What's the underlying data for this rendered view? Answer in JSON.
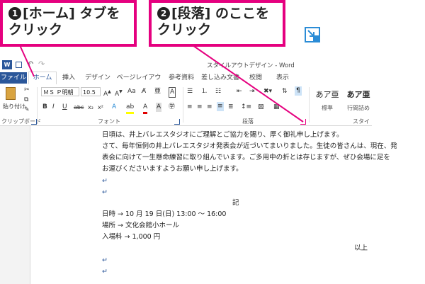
{
  "callouts": [
    {
      "num": "❶",
      "line1": "[ホーム] タブを",
      "line2": "クリック"
    },
    {
      "num": "❷",
      "line1": "[段落] のここを",
      "line2": "クリック"
    }
  ],
  "window": {
    "title": "スタイルアウトデザイン - Word",
    "qat": [
      "W",
      "↶",
      "↷"
    ]
  },
  "tabs": [
    "ファイル",
    "ホーム",
    "挿入",
    "デザイン",
    "ページレイアウト",
    "参考資料",
    "差し込み文書",
    "校閲",
    "表示"
  ],
  "ribbon": {
    "clipboard": {
      "label": "クリップボード",
      "paste": "貼り付け"
    },
    "font": {
      "label": "フォント",
      "name": "ＭＳ Ｐ明朝",
      "size": "10.5"
    },
    "paragraph": {
      "label": "段落"
    },
    "styles": {
      "label": "スタイル",
      "items": [
        {
          "sample": "あア亜",
          "name": "標準"
        },
        {
          "sample": "あア亜",
          "name": "行間詰め"
        }
      ]
    }
  },
  "document": {
    "lines": [
      "日頃は、井上バレエスタジオにご理解とご協力を賜り、厚く御礼申し上げます。",
      "さて、毎年恒例の井上バレエスタジオ発表会が近づいてまいりました。生徒の皆さんは、現在、発",
      "表会に向けて一生懸命練習に取り組んでいます。ご多用中の折とは存じますが、ぜひ会場に足を",
      "お運びくださいますようお願い申し上げます。",
      "",
      "",
      "記",
      "日時 → 10 月 19 日(日) 13:00 ～ 16:00",
      "場所 → 文化会館小ホール",
      "入場料 → 1,000 円",
      "以上",
      "",
      ""
    ]
  }
}
